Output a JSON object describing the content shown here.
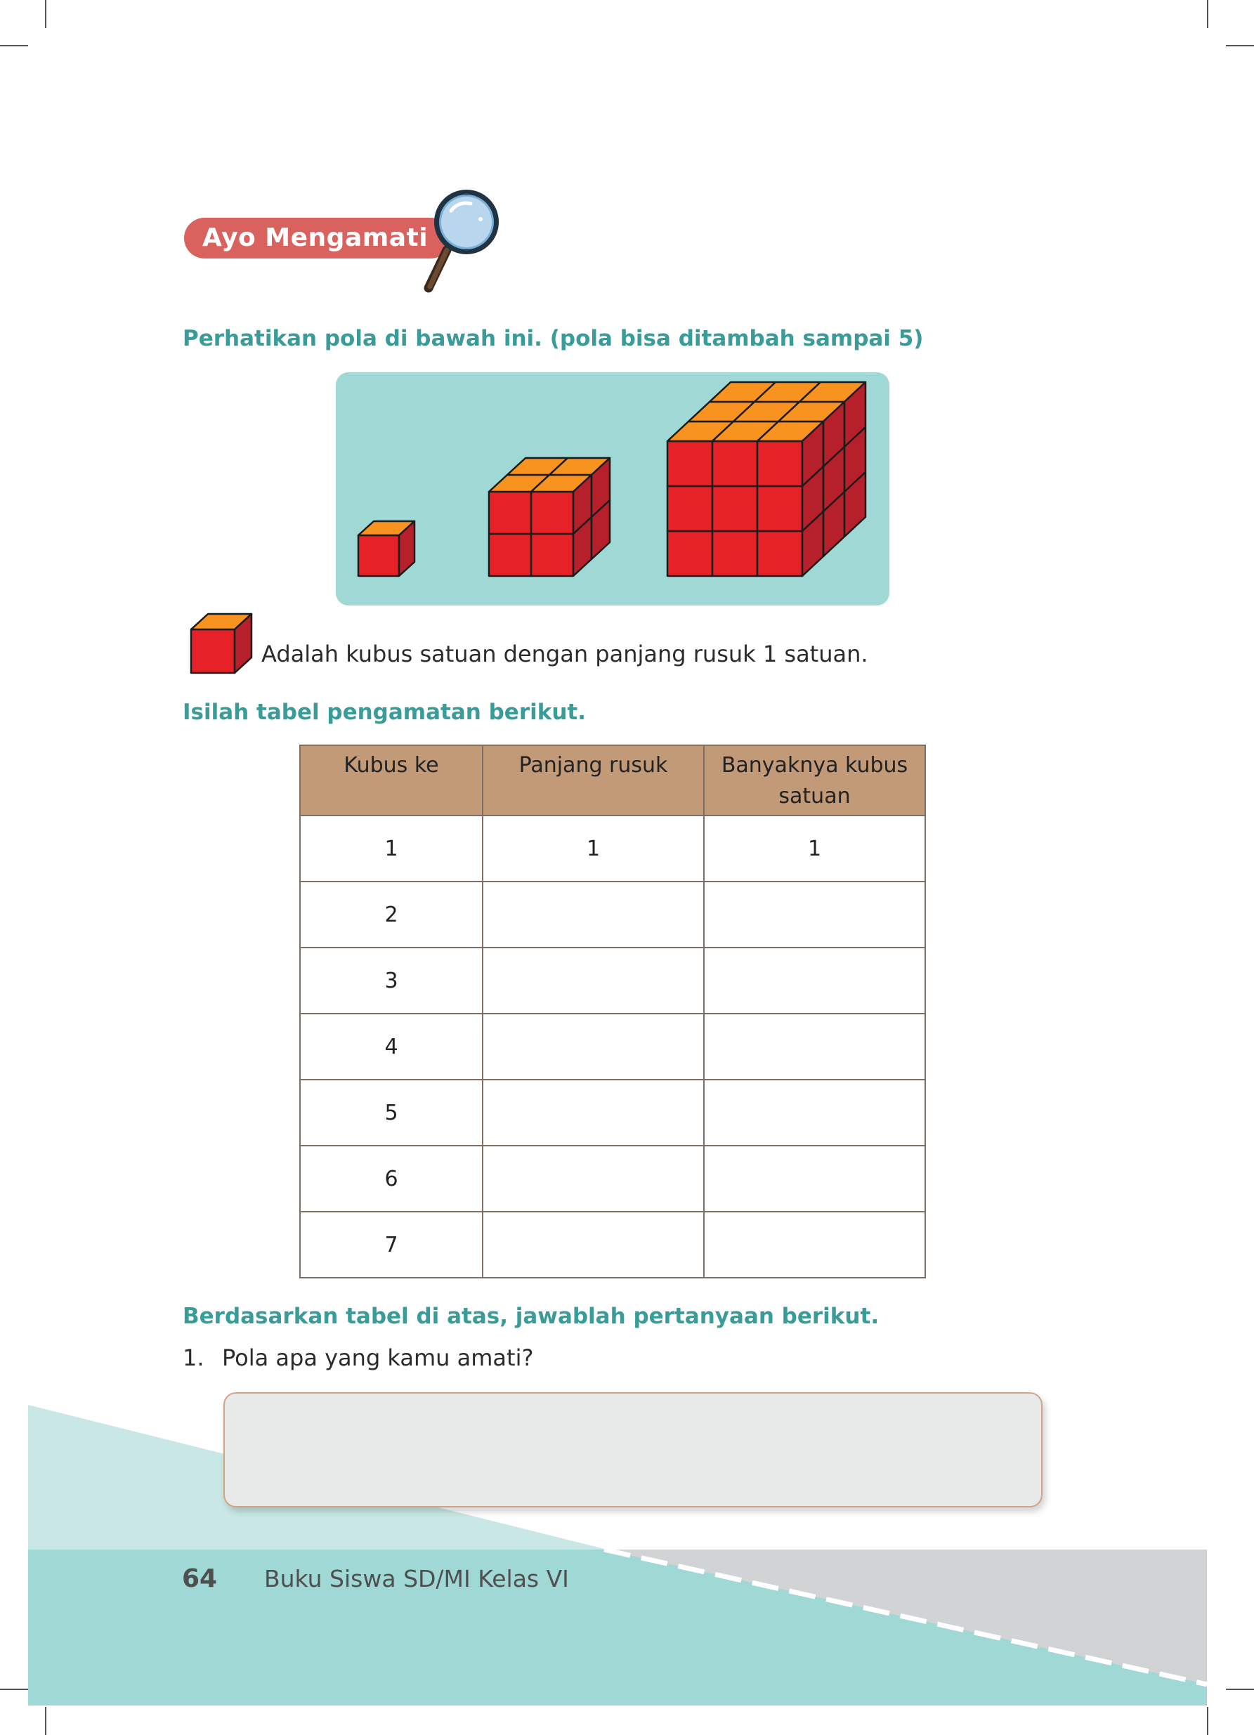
{
  "section": {
    "badge_label": "Ayo Mengamati"
  },
  "instruction_heading": "Perhatikan pola di bawah ini. (pola bisa ditambah sampai 5)",
  "cube_pattern": {
    "items": [
      {
        "edge_length": 1
      },
      {
        "edge_length": 2
      },
      {
        "edge_length": 3
      }
    ]
  },
  "unit_cube_note": "Adalah kubus satuan dengan panjang rusuk 1 satuan.",
  "table_heading": "Isilah tabel pengamatan berikut.",
  "table": {
    "headers": [
      "Kubus ke",
      "Panjang rusuk",
      "Banyaknya kubus satuan"
    ],
    "rows": [
      [
        "1",
        "1",
        "1"
      ],
      [
        "2",
        "",
        ""
      ],
      [
        "3",
        "",
        ""
      ],
      [
        "4",
        "",
        ""
      ],
      [
        "5",
        "",
        ""
      ],
      [
        "6",
        "",
        ""
      ],
      [
        "7",
        "",
        ""
      ]
    ]
  },
  "questions_heading": "Berdasarkan tabel di atas, jawablah pertanyaan berikut.",
  "question_1": {
    "number": "1.",
    "text": "Pola apa yang kamu amati?"
  },
  "footer": {
    "page_number": "64",
    "book_title": "Buku Siswa SD/MI Kelas VI"
  },
  "colors": {
    "badge": "#d9625e",
    "heading_teal": "#3a9c98",
    "panel_teal": "#9fd8d4",
    "cube_front": "#e62127",
    "cube_top": "#f7931e",
    "cube_side": "#b5202b",
    "table_header": "#c39a78"
  }
}
